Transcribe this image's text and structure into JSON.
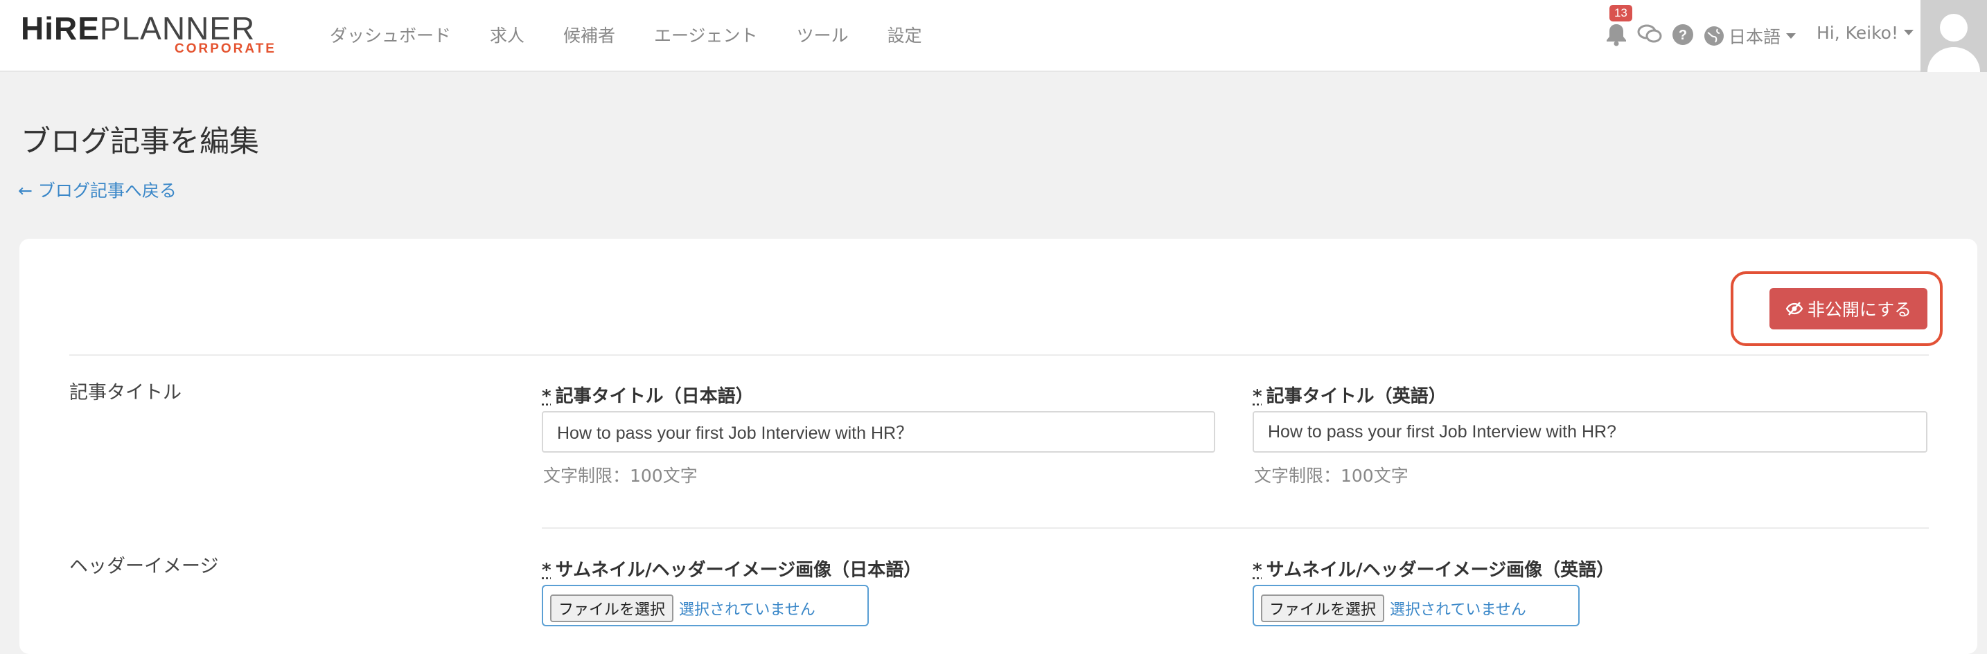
{
  "brand": {
    "hire": "HiRE",
    "planner": "PLANNER",
    "sub": "CORPORATE",
    "accent": "#e4532f"
  },
  "nav": {
    "items": [
      {
        "label": "ダッシュボード"
      },
      {
        "label": "求人"
      },
      {
        "label": "候補者"
      },
      {
        "label": "エージェント"
      },
      {
        "label": "ツール"
      },
      {
        "label": "設定"
      }
    ],
    "notifications_count": "13",
    "language": "日本語",
    "user_greeting": "Hi, Keiko!"
  },
  "page": {
    "title": "ブログ記事を編集",
    "back_link": "← ブログ記事へ戻る"
  },
  "actions": {
    "unpublish_label": "非公開にする",
    "unpublish_color": "#d35452"
  },
  "form": {
    "title_section": {
      "label": "記事タイトル",
      "ja": {
        "required": "*",
        "label": "記事タイトル（日本語）",
        "value": "How to pass your first Job Interview with HR？",
        "hint": "文字制限：100文字"
      },
      "en": {
        "required": "*",
        "label": "記事タイトル（英語）",
        "value": "How to pass your first Job Interview with HR?",
        "hint": "文字制限：100文字"
      }
    },
    "header_section": {
      "label": "ヘッダーイメージ",
      "ja": {
        "required": "*",
        "label": "サムネイル/ヘッダーイメージ画像（日本語）",
        "file_button": "ファイルを選択",
        "file_status": "選択されていません"
      },
      "en": {
        "required": "*",
        "label": "サムネイル/ヘッダーイメージ画像（英語）",
        "file_button": "ファイルを選択",
        "file_status": "選択されていません"
      }
    }
  }
}
